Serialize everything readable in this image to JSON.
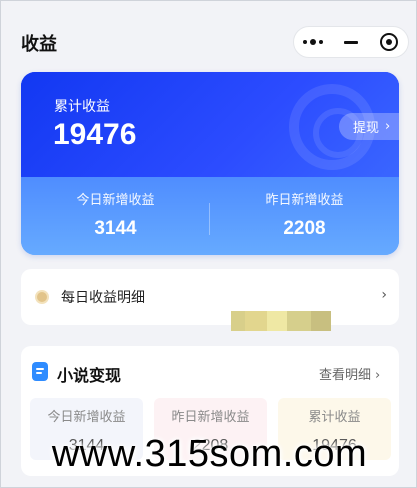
{
  "header": {
    "title": "收益",
    "capsule": {
      "more_icon": "more-dots-icon",
      "minimize_icon": "minus-icon",
      "close_icon": "target-icon"
    }
  },
  "summary": {
    "total_label": "累计收益",
    "total_value": "19476",
    "withdraw_label": "提现",
    "today_label": "今日新增收益",
    "today_value": "3144",
    "yesterday_label": "昨日新增收益",
    "yesterday_value": "2208",
    "colors": {
      "top": "#1238f2",
      "bottom": "#66aaff"
    }
  },
  "daily_detail": {
    "label": "每日收益明细",
    "icon": "coin-icon"
  },
  "masked_strip": {
    "colors": [
      "#d8cf8a",
      "#e2d68e",
      "#efe8a4",
      "#d6cf8c",
      "#c8bf80"
    ]
  },
  "novel": {
    "title": "小说变现",
    "icon": "document-icon",
    "view_detail_label": "查看明细",
    "stats": [
      {
        "label": "今日新增收益",
        "value": "3144",
        "bg": "#f3f5fb"
      },
      {
        "label": "昨日新增收益",
        "value": "2208",
        "bg": "#fdf2f4"
      },
      {
        "label": "累计收益",
        "value": "19476",
        "bg": "#fdf8ea"
      }
    ]
  },
  "watermark": {
    "text": "www.315som.com"
  }
}
